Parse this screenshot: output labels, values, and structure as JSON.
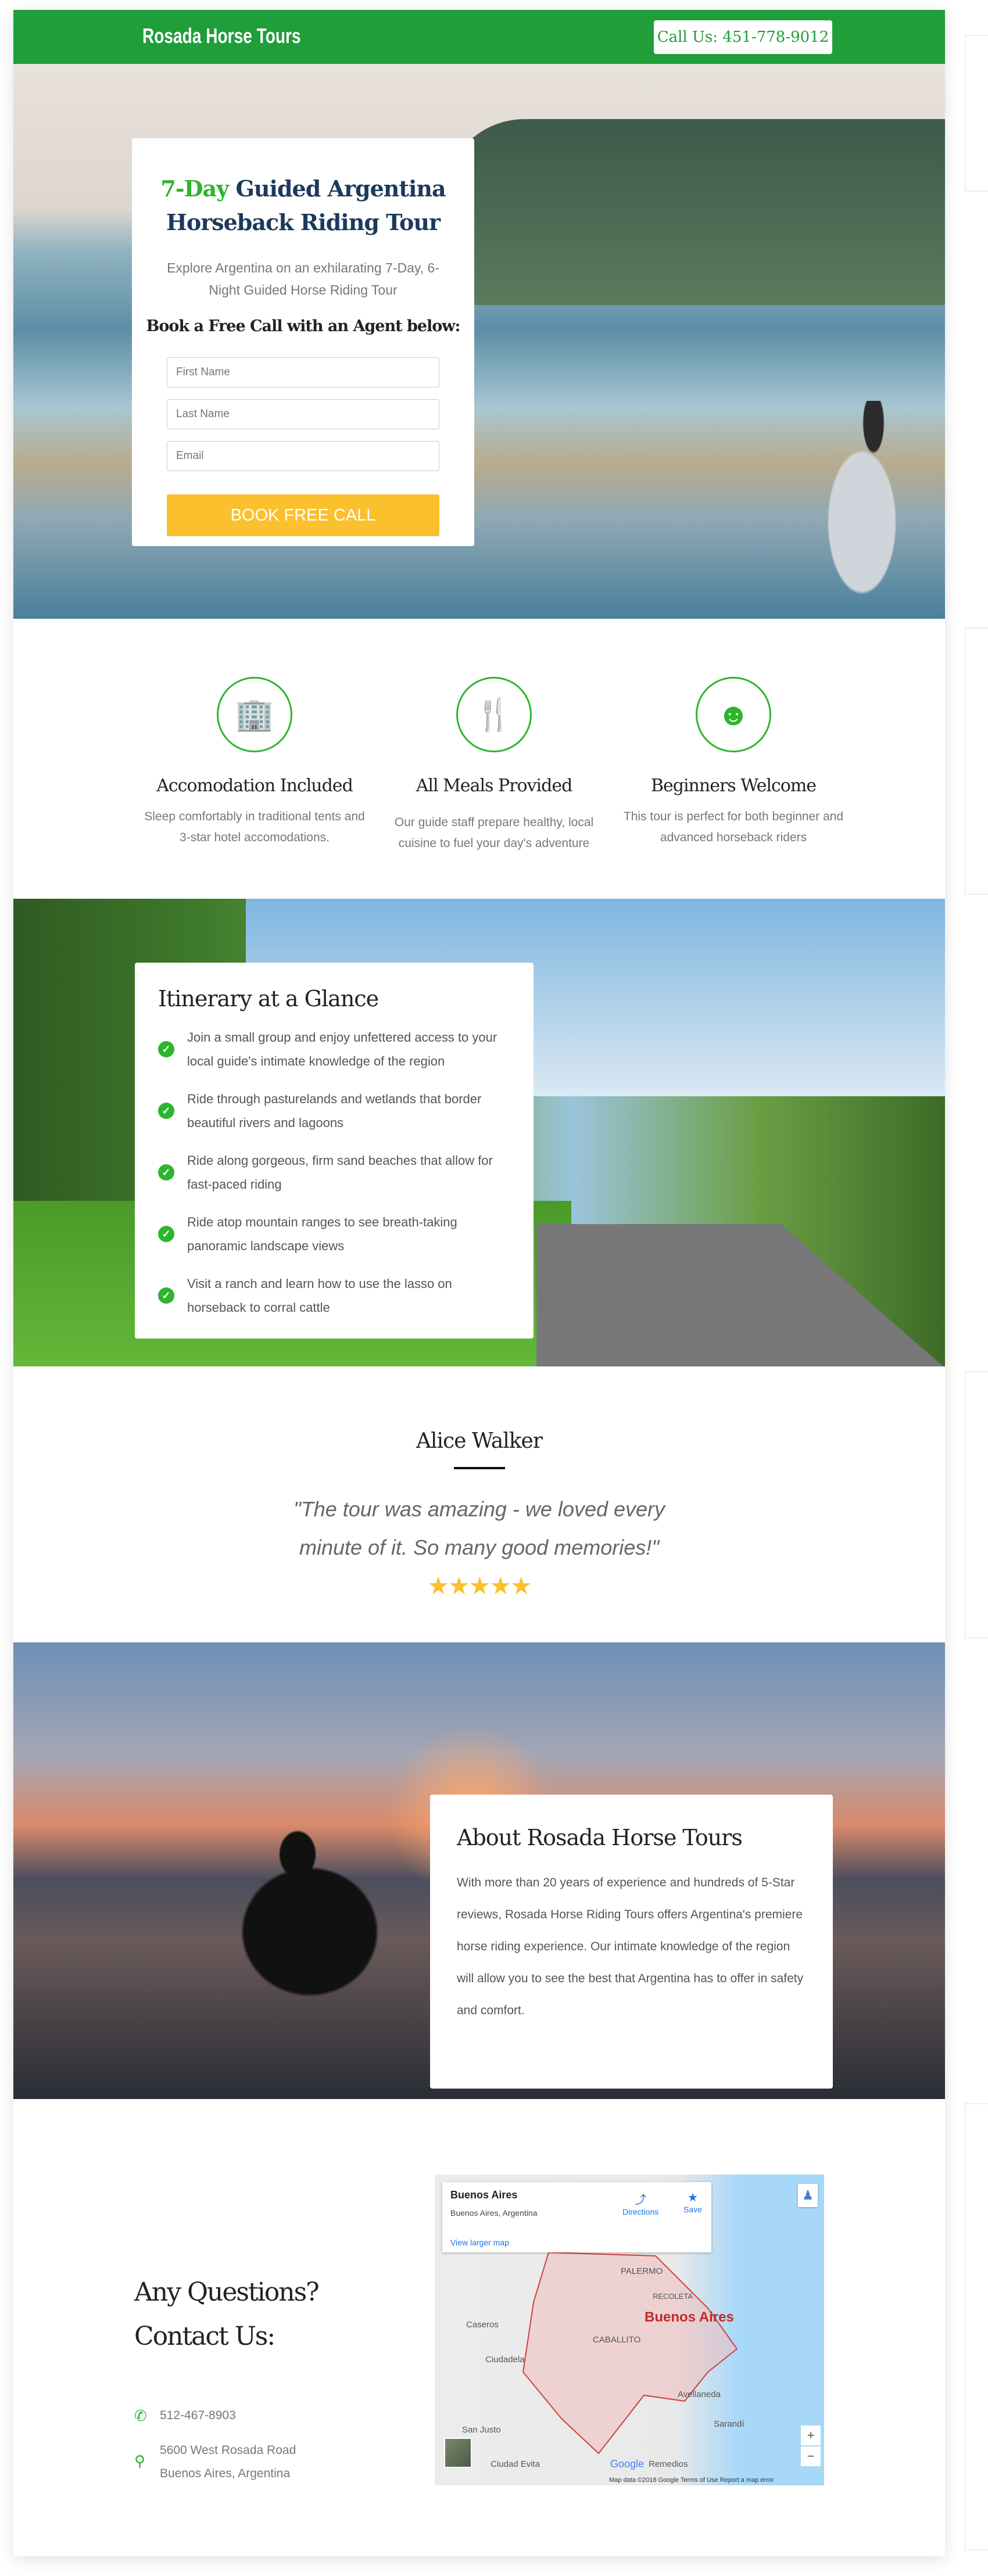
{
  "header": {
    "logo": "Rosada Horse Tours",
    "call_label": "Call Us: 451-778-9012"
  },
  "hero": {
    "title_highlight": "7-Day",
    "title_rest": " Guided Argentina Horseback Riding Tour",
    "subtitle": "Explore Argentina on an exhilarating 7-Day, 6-Night Guided Horse Riding Tour",
    "form_heading": "Book a Free Call with an Agent below:",
    "first_name_placeholder": "First Name",
    "last_name_placeholder": "Last Name",
    "email_placeholder": "Email",
    "submit_label": "BOOK FREE CALL"
  },
  "features": [
    {
      "icon": "building-icon",
      "title": "Accomodation Included",
      "desc": "Sleep comfortably in traditional tents and 3-star hotel accomodations."
    },
    {
      "icon": "utensils-icon",
      "title": "All Meals Provided",
      "desc": "Our guide staff prepare healthy, local cuisine to fuel your day's adventure"
    },
    {
      "icon": "child-face-icon",
      "title": "Beginners Welcome",
      "desc": "This tour is perfect for both beginner and advanced horseback riders"
    }
  ],
  "itinerary": {
    "heading": "Itinerary at a Glance",
    "items": [
      "Join a small group and enjoy unfettered access to your local guide's intimate knowledge of the region",
      "Ride through pasturelands and wetlands that border beautiful rivers and lagoons",
      "Ride along gorgeous, firm sand beaches that allow for fast-paced riding",
      "Ride atop mountain ranges to see breath-taking panoramic landscape views",
      "Visit a ranch and learn how to use the lasso on horseback to corral cattle"
    ]
  },
  "testimonial": {
    "name": "Alice Walker",
    "quote": "\"The tour was amazing - we loved every minute of it. So many good memories!\"",
    "rating": 5,
    "stars": "★★★★★"
  },
  "about": {
    "heading": "About Rosada Horse Tours",
    "body": "With more than 20 years of experience and hundreds of 5-Star reviews, Rosada Horse Riding Tours offers Argentina's premiere horse riding experience. Our intimate knowledge of the region will allow you to see the best that Argentina has to offer in safety and comfort."
  },
  "contact": {
    "heading_line1": "Any Questions?",
    "heading_line2": "Contact Us:",
    "phone": "512-467-8903",
    "address_line1": "5600 West Rosada Road",
    "address_line2": "Buenos Aires, Argentina"
  },
  "map": {
    "place": "Buenos Aires",
    "place_sub": "Buenos Aires, Argentina",
    "directions": "Directions",
    "save": "Save",
    "view_larger": "View larger map",
    "city_label": "Buenos Aires",
    "labels": [
      "PALERMO",
      "RECOLETA",
      "CABALLITO",
      "Caseros",
      "Ciudadela",
      "Avellaneda",
      "Sarandí",
      "San Justo",
      "Ciudad Evita",
      "Remedios"
    ],
    "footer": "Map data ©2018 Google   Terms of Use   Report a map error",
    "google": "Google"
  },
  "colors": {
    "brand_green": "#1f9e3a",
    "accent_green": "#2db52d",
    "button_yellow": "#fbc02d",
    "title_navy": "#1b3a5c"
  }
}
